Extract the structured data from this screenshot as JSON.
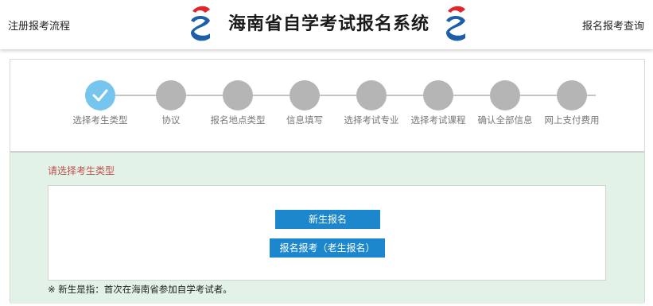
{
  "header": {
    "left_link": "注册报考流程",
    "title": "海南省自学考试报名系统",
    "right_link": "报名报考查询",
    "logo_colors": {
      "red": "#e0262b",
      "blue": "#1c5fa8"
    }
  },
  "steps": [
    {
      "label": "选择考生类型",
      "status": "done"
    },
    {
      "label": "协议",
      "status": "pending"
    },
    {
      "label": "报名地点类型",
      "status": "pending"
    },
    {
      "label": "信息填写",
      "status": "pending"
    },
    {
      "label": "选择考试专业",
      "status": "pending"
    },
    {
      "label": "选择考试课程",
      "status": "pending"
    },
    {
      "label": "确认全部信息",
      "status": "pending"
    },
    {
      "label": "网上支付费用",
      "status": "pending"
    }
  ],
  "section": {
    "title": "请选择考生类型",
    "new_button": "新生报名",
    "old_button": "报名报考（老生报名）",
    "note": "※ 新生是指：首次在海南省参加自学考试者。"
  },
  "colors": {
    "active_step": "#75c5ef",
    "pending_step": "#b5b5b5",
    "button": "#1c87cc",
    "content_bg": "#e3f2e7",
    "section_title": "#c0504d"
  }
}
